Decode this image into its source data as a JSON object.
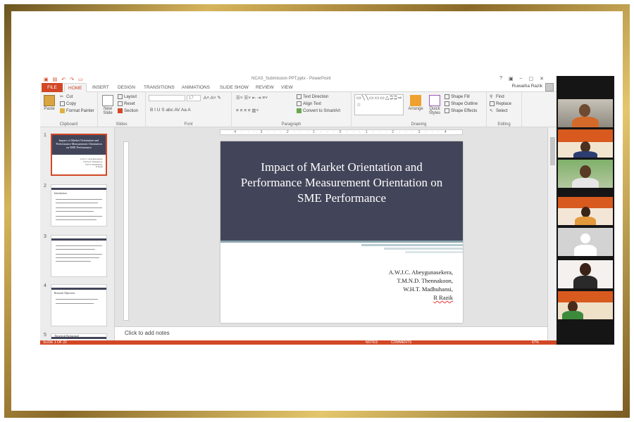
{
  "window": {
    "title": "NCAS_Submission PPT.pptx - PowerPoint",
    "controls": [
      "?",
      "▣",
      "–",
      "▢",
      "✕"
    ],
    "user": "Ruwaiha Razik"
  },
  "ribbon_tabs": {
    "file": "FILE",
    "items": [
      "HOME",
      "INSERT",
      "DESIGN",
      "TRANSITIONS",
      "ANIMATIONS",
      "SLIDE SHOW",
      "REVIEW",
      "VIEW"
    ]
  },
  "ribbon": {
    "clipboard": {
      "label": "Clipboard",
      "paste": "Paste",
      "cut": "Cut",
      "copy": "Copy",
      "format_painter": "Format Painter"
    },
    "slides": {
      "label": "Slides",
      "new_slide": "New Slide",
      "layout": "Layout",
      "reset": "Reset",
      "section": "Section"
    },
    "font": {
      "label": "Font",
      "size": "17",
      "buttons": "B  I  U  S  abc  AV  Aa  A"
    },
    "paragraph": {
      "label": "Paragraph",
      "text_direction": "Text Direction",
      "align_text": "Align Text",
      "convert_smartart": "Convert to SmartArt"
    },
    "drawing": {
      "label": "Drawing",
      "arrange": "Arrange",
      "quick_styles": "Quick Styles",
      "shape_fill": "Shape Fill",
      "shape_outline": "Shape Outline",
      "shape_effects": "Shape Effects",
      "shapes_glyphs": "▭╲╲▭▭▭△ℶℶ⇨◯{}☆"
    },
    "editing": {
      "label": "Editing",
      "find": "Find",
      "replace": "Replace",
      "select": "Select"
    }
  },
  "ruler": "4 · · · 3 · · · 2 · · · 1 · · · 0 · · · 1 · · · 2 · · · 3 · · · 4",
  "thumbnails": [
    {
      "num": "1",
      "title": "Impact of Market Orientation and Performance Measurement Orientation on SME Performance",
      "authors": [
        "A.W.J.C. Abeygunasekera,",
        "T.M.N.D. Thennakoon,",
        "W.H.T. Madhuhansi,",
        "R Razik"
      ]
    },
    {
      "num": "2",
      "heading": "Introduction"
    },
    {
      "num": "3",
      "heading": ""
    },
    {
      "num": "4",
      "heading": "Research Objectives"
    },
    {
      "num": "5",
      "heading": "Theoretical Background"
    }
  ],
  "slide": {
    "title": "Impact of Market Orientation and Performance Measurement Orientation on SME Performance",
    "authors": [
      "A.W.J.C. Abeygunasekera,",
      "T.M.N.D. Thennakoon,",
      "W.H.T. Madhuhansi,",
      "R Razik"
    ]
  },
  "notes_placeholder": "Click to add notes",
  "status": {
    "slide": "SLIDE 1 OF 22",
    "notes": "NOTES",
    "comments": "COMMENTS",
    "zoom": "67%"
  },
  "colors": {
    "accent": "#d24726",
    "slide_band": "#424559",
    "stripe": "#8aa5ae",
    "frame_gold": "#c9a24a"
  },
  "video_participants": [
    "participant-1",
    "participant-2",
    "participant-3",
    "participant-4",
    "participant-5",
    "participant-6",
    "participant-7"
  ]
}
